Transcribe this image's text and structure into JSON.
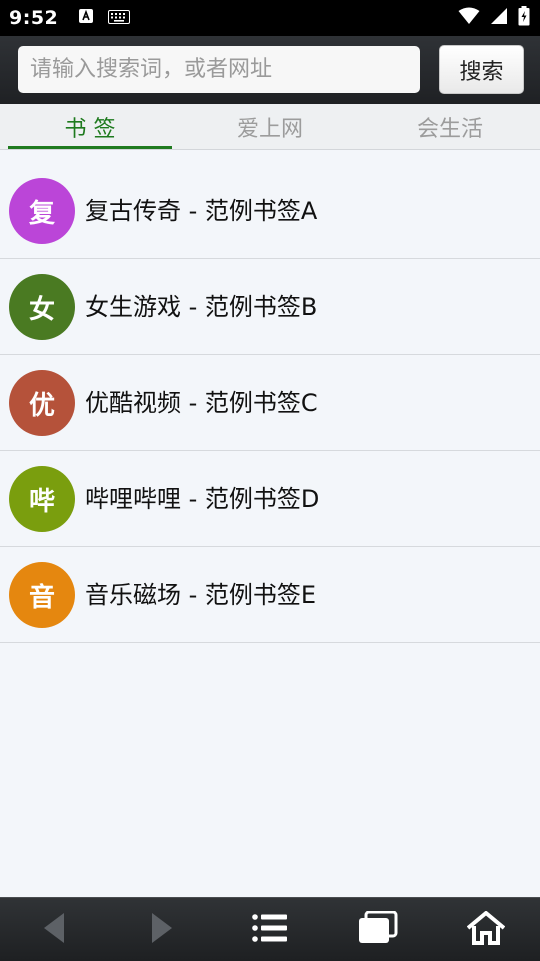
{
  "status_bar": {
    "time": "9:52",
    "icons": [
      "a-badge-icon",
      "keyboard-icon",
      "wifi-icon",
      "signal-icon",
      "battery-icon"
    ]
  },
  "search": {
    "placeholder": "请输入搜索词，或者网址",
    "button_label": "搜索"
  },
  "tabs": [
    {
      "label": "书 签",
      "active": true
    },
    {
      "label": "爱上网",
      "active": false
    },
    {
      "label": "会生活",
      "active": false
    }
  ],
  "bookmarks": [
    {
      "avatar": "复",
      "title": "复古传奇 - 范例书签A",
      "color": "#bb45d8"
    },
    {
      "avatar": "女",
      "title": "女生游戏 - 范例书签B",
      "color": "#4a7a22"
    },
    {
      "avatar": "优",
      "title": "优酷视频 - 范例书签C",
      "color": "#b5523a"
    },
    {
      "avatar": "哔",
      "title": "哔哩哔哩 - 范例书签D",
      "color": "#7a9e0e"
    },
    {
      "avatar": "音",
      "title": "音乐磁场 - 范例书签E",
      "color": "#e5870f"
    }
  ],
  "bottom_nav": [
    "back-arrow-icon",
    "forward-arrow-icon",
    "menu-list-icon",
    "windows-icon",
    "home-icon"
  ],
  "colors": {
    "accent": "#1e7a1e",
    "tab_inactive": "#9c9c9c",
    "background": "#f3f6fa"
  }
}
